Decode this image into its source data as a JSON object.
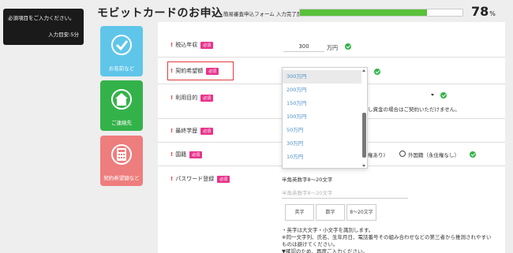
{
  "notice": {
    "line1": "必須項目をご入力ください。",
    "line2": "入力目安:5分"
  },
  "header": {
    "title": "モビットカードのお申込",
    "progress_label": "簡易審査申込フォーム 入力完了度",
    "progress_value": 78,
    "progress_value_text": "78",
    "progress_unit": "%"
  },
  "steps": [
    {
      "label": "お名前など",
      "icon": "checkmark-icon",
      "color": "#5fc6ea"
    },
    {
      "label": "ご連絡先",
      "icon": "house-icon",
      "color": "#34b24a"
    },
    {
      "label": "契約希望額など",
      "icon": "calculator-icon",
      "color": "#ee7d7d"
    }
  ],
  "form": {
    "required_badge": "必須",
    "income": {
      "label": "税込年収",
      "value": "300",
      "unit": "万円"
    },
    "desired_amount": {
      "label": "契約希望額",
      "options": [
        "300万円",
        "200万円",
        "150万円",
        "100万円",
        "50万円",
        "30万円",
        "10万円"
      ],
      "selected": "300万円"
    },
    "purpose": {
      "label": "利用目的",
      "note": "し資金の場合はご契約いただけません。"
    },
    "education": {
      "label": "最終学歴"
    },
    "nationality": {
      "label": "国籍",
      "option_partial": "権あり)",
      "option_foreign": "外国籍（永住権なし）"
    },
    "password": {
      "label": "パスワード登録",
      "rule": "半角英数字8～20文字",
      "placeholder": "半角英数字8～20文字",
      "tags": [
        "英字",
        "数字",
        "8～20文字"
      ],
      "notes": [
        "・英字は大文字・小文字を識別します。",
        "※同一文字列、氏名、生年月日、電話番号その組み合わせなどの第三者から推測されやすい",
        "ものは避けてください。",
        "▼確認のため、再度ご入力ください。"
      ]
    }
  },
  "colors": {
    "accent_green": "#59c13a",
    "step_blue": "#5fc6ea",
    "step_green": "#34b24a",
    "step_red": "#ee7d7d",
    "required_pink": "#e8348c",
    "highlight_red": "#e03b3b",
    "option_blue": "#4a8fc9"
  }
}
